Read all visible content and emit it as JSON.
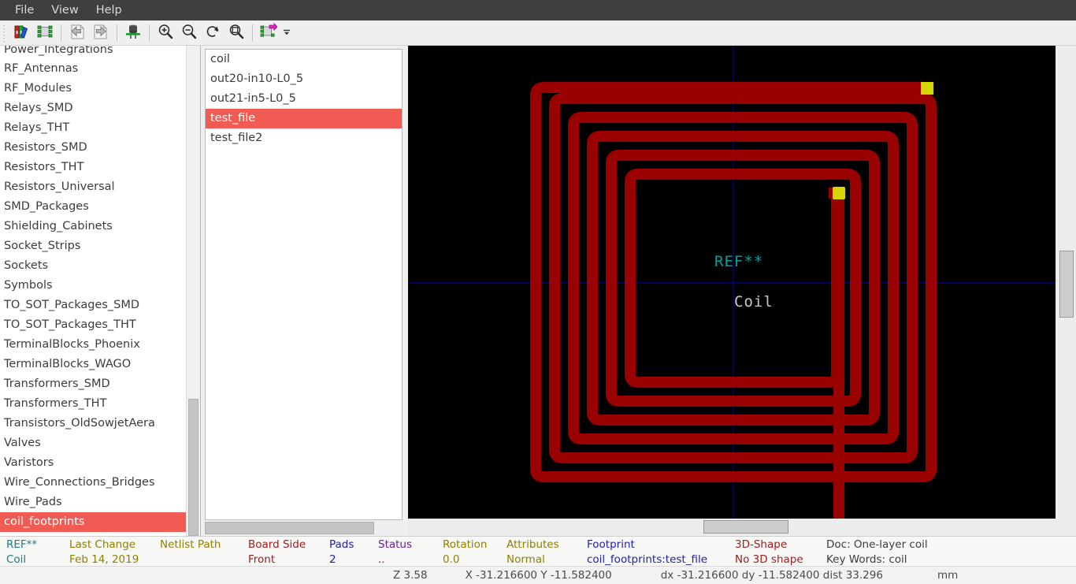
{
  "window": {
    "menu": [
      {
        "label": "File",
        "name": "menu-file"
      },
      {
        "label": "View",
        "name": "menu-view"
      },
      {
        "label": "Help",
        "name": "menu-help"
      }
    ]
  },
  "toolbar": {
    "buttons": [
      {
        "icon": "select-library-icon",
        "tooltip": "Select library"
      },
      {
        "icon": "select-footprint-icon",
        "tooltip": "Select footprint"
      },
      {
        "icon": "previous-footprint-icon",
        "tooltip": "Display previous footprint"
      },
      {
        "icon": "next-footprint-icon",
        "tooltip": "Display next footprint"
      },
      {
        "icon": "3d-view-icon",
        "tooltip": "3D Display"
      },
      {
        "icon": "zoom-in-icon",
        "tooltip": "Zoom in"
      },
      {
        "icon": "zoom-out-icon",
        "tooltip": "Zoom out"
      },
      {
        "icon": "refresh-icon",
        "tooltip": "Redraw view"
      },
      {
        "icon": "zoom-fit-icon",
        "tooltip": "Zoom auto"
      },
      {
        "icon": "insert-footprint-icon",
        "tooltip": "Insert footprint in board"
      },
      {
        "icon": "chevron-down-icon",
        "tooltip": "Toolbar overflow"
      }
    ]
  },
  "library_panel": {
    "name": "library-list",
    "items": [
      "Power_Integrations",
      "RF_Antennas",
      "RF_Modules",
      "Relays_SMD",
      "Relays_THT",
      "Resistors_SMD",
      "Resistors_THT",
      "Resistors_Universal",
      "SMD_Packages",
      "Shielding_Cabinets",
      "Socket_Strips",
      "Sockets",
      "Symbols",
      "TO_SOT_Packages_SMD",
      "TO_SOT_Packages_THT",
      "TerminalBlocks_Phoenix",
      "TerminalBlocks_WAGO",
      "Transformers_SMD",
      "Transformers_THT",
      "Transistors_OldSowjetAera",
      "Valves",
      "Varistors",
      "Wire_Connections_Bridges",
      "Wire_Pads",
      "coil_footprints"
    ],
    "selected": "coil_footprints",
    "selected_index": 24
  },
  "footprint_panel": {
    "name": "footprint-list",
    "items": [
      "coil",
      "out20-in10-L0_5",
      "out21-in5-L0_5",
      "test_file",
      "test_file2"
    ],
    "selected": "test_file",
    "selected_index": 3
  },
  "canvas": {
    "name": "footprint-canvas",
    "background_color": "#000000",
    "reference_text": "REF**",
    "reference_color": "#00a0a0",
    "value_text": "Coil",
    "value_color": "#c8c8c8",
    "trace_color": "#990000",
    "pad_color": "#d6d600",
    "axis_color": "#00008b",
    "turns": 6
  },
  "info": {
    "columns": [
      {
        "label": "REF**",
        "value": "Coil",
        "color": "#1c7d86"
      },
      {
        "label": "Last Change",
        "value": "Feb 14, 2019",
        "color": "#8f8000"
      },
      {
        "label": "Netlist Path",
        "value": "",
        "color": "#8f8000"
      },
      {
        "label": "Board Side",
        "value": "Front",
        "color": "#9e1c1c"
      },
      {
        "label": "Pads",
        "value": "2",
        "color": "#1f1fa8"
      },
      {
        "label": "Status",
        "value": "..",
        "color": "#6b1f9e"
      },
      {
        "label": "Rotation",
        "value": "0.0",
        "color": "#8f8000"
      },
      {
        "label": "Attributes",
        "value": "Normal",
        "color": "#8f8000"
      },
      {
        "label": "Footprint",
        "value": "coil_footprints:test_file",
        "color": "#1f1fa8"
      },
      {
        "label": "3D-Shape",
        "value": "No 3D shape",
        "color": "#9e1c1c"
      },
      {
        "label": "Doc: One-layer coil",
        "value": "Key Words: coil",
        "color": "#3c3c3c"
      }
    ]
  },
  "coordbar": {
    "zoom": "Z 3.58",
    "absolute": "X -31.216600 Y -11.582400",
    "relative": "dx -31.216600 dy -11.582400 dist 33.296",
    "units": "mm"
  }
}
